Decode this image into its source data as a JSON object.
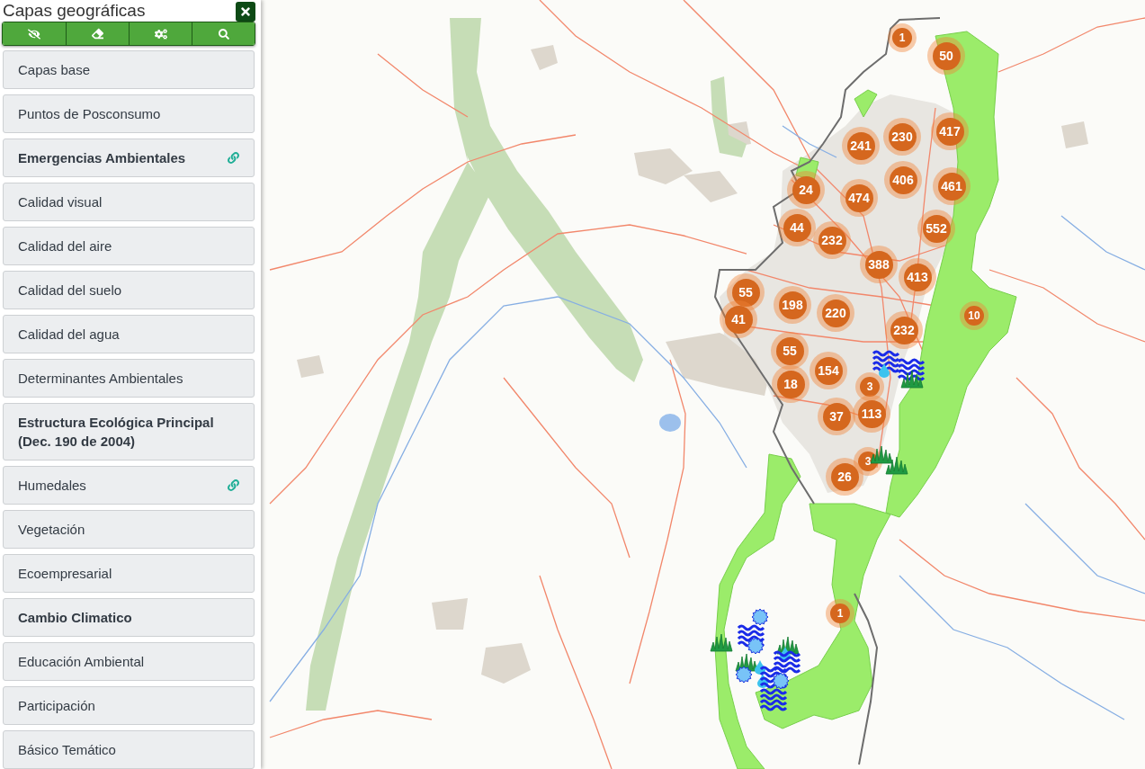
{
  "sidebar": {
    "title": "Capas geográficas",
    "layers": [
      {
        "label": "Capas base",
        "emphasized": false,
        "linked": false
      },
      {
        "label": "Puntos de Posconsumo",
        "emphasized": false,
        "linked": false
      },
      {
        "label": "Emergencias Ambientales",
        "emphasized": true,
        "linked": true
      },
      {
        "label": "Calidad visual",
        "emphasized": false,
        "linked": false
      },
      {
        "label": "Calidad del aire",
        "emphasized": false,
        "linked": false
      },
      {
        "label": "Calidad del suelo",
        "emphasized": false,
        "linked": false
      },
      {
        "label": "Calidad del agua",
        "emphasized": false,
        "linked": false
      },
      {
        "label": "Determinantes Ambientales",
        "emphasized": false,
        "linked": false
      },
      {
        "label": "Estructura Ecológica Principal (Dec. 190 de 2004)",
        "emphasized": true,
        "linked": false
      },
      {
        "label": "Humedales",
        "emphasized": false,
        "linked": true
      },
      {
        "label": "Vegetación",
        "emphasized": false,
        "linked": false
      },
      {
        "label": "Ecoempresarial",
        "emphasized": false,
        "linked": false
      },
      {
        "label": "Cambio Climatico",
        "emphasized": true,
        "linked": false
      },
      {
        "label": "Educación Ambiental",
        "emphasized": false,
        "linked": false
      },
      {
        "label": "Participación",
        "emphasized": false,
        "linked": false
      },
      {
        "label": "Básico Temático",
        "emphasized": false,
        "linked": false
      }
    ]
  },
  "map": {
    "clusters": [
      {
        "count": "1"
      },
      {
        "count": "50"
      },
      {
        "count": "241"
      },
      {
        "count": "230"
      },
      {
        "count": "417"
      },
      {
        "count": "24"
      },
      {
        "count": "474"
      },
      {
        "count": "406"
      },
      {
        "count": "461"
      },
      {
        "count": "44"
      },
      {
        "count": "232"
      },
      {
        "count": "552"
      },
      {
        "count": "388"
      },
      {
        "count": "413"
      },
      {
        "count": "55"
      },
      {
        "count": "198"
      },
      {
        "count": "220"
      },
      {
        "count": "232"
      },
      {
        "count": "10"
      },
      {
        "count": "41"
      },
      {
        "count": "55"
      },
      {
        "count": "154"
      },
      {
        "count": "3"
      },
      {
        "count": "18"
      },
      {
        "count": "37"
      },
      {
        "count": "113"
      },
      {
        "count": "3"
      },
      {
        "count": "26"
      },
      {
        "count": "1"
      }
    ]
  }
}
